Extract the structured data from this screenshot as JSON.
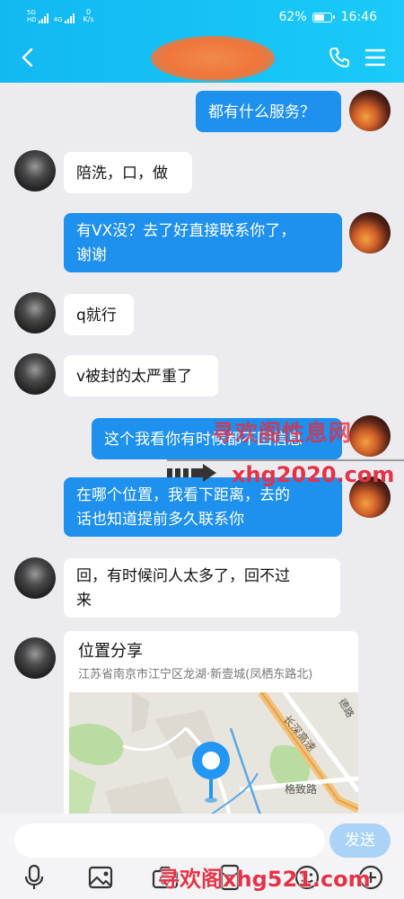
{
  "status_bar": {
    "sim1": "5G",
    "sim1_sub": "HD",
    "sim2": "4G",
    "net_speed_value": "0",
    "net_speed_unit": "K/s",
    "battery": "62%",
    "battery_level": 0.62,
    "time": "16:46"
  },
  "header": {
    "contact_name": "",
    "back_icon": "chevron-left-icon",
    "phone_icon": "phone-icon",
    "menu_icon": "menu-icon"
  },
  "messages": [
    {
      "side": "out",
      "text": "都有什么服务？"
    },
    {
      "side": "in",
      "text": "陪洗，口，做"
    },
    {
      "side": "out",
      "text": "有VX没？去了好直接联系你了，\n谢谢"
    },
    {
      "side": "in",
      "text": "q就行"
    },
    {
      "side": "in",
      "text": "v被封的太严重了"
    },
    {
      "side": "out",
      "text": "这个我看你有时候都不回信息"
    },
    {
      "side": "out",
      "text": "在哪个位置，我看下距离，去的\n话也知道提前多久联系你"
    },
    {
      "side": "in",
      "text": "回，有时候问人太多了，回不过\n来"
    }
  ],
  "location_card": {
    "title": "位置分享",
    "address": "江苏省南京市江宁区龙湖·新壹城(凤栖东路北)",
    "map_labels": {
      "road1": "长深高速",
      "road2": "格致路",
      "road3": "德路"
    }
  },
  "watermarks": {
    "top": "寻欢阁性息网",
    "middle": "xhg2020.com",
    "bottom": "寻欢阁xhg521.com"
  },
  "input_bar": {
    "placeholder": "",
    "send_label": "发送",
    "tools": [
      "microphone-icon",
      "image-icon",
      "camera-icon",
      "red-packet-icon",
      "emoji-icon",
      "plus-icon"
    ]
  },
  "colors": {
    "header_gradient_start": "#12b8f2",
    "outgoing_bubble": "#1e90ee",
    "incoming_bubble": "#ffffff",
    "chat_background": "#ececf0",
    "send_button": "#a9d3f7",
    "watermark_red": "#e63246",
    "redaction_orange": "#f0763a"
  }
}
